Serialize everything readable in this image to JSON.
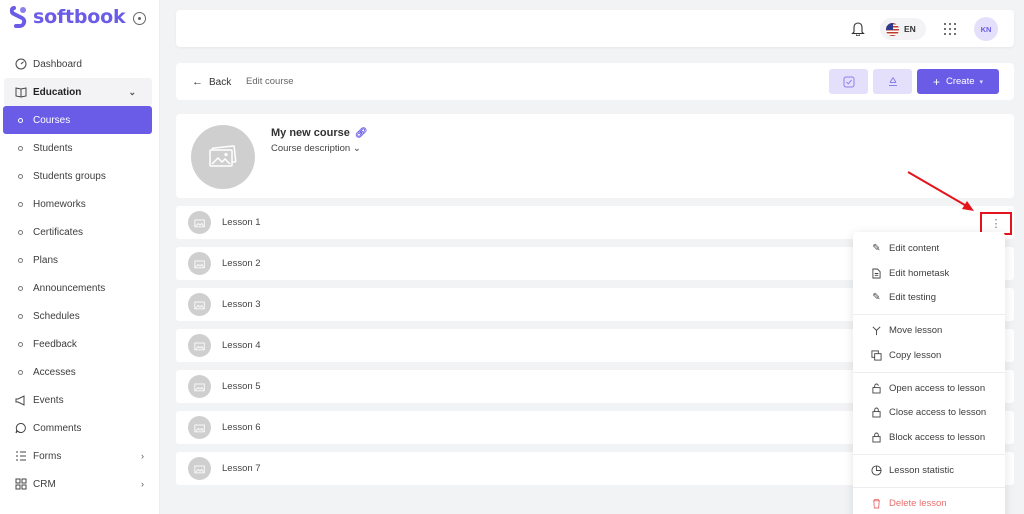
{
  "brand": {
    "name": "softbook",
    "color": "#6b5ce7"
  },
  "sidebar": {
    "items": [
      {
        "label": "Dashboard",
        "icon": "dashboard-gauge-icon",
        "type": "top"
      },
      {
        "label": "Education",
        "icon": "book-icon",
        "type": "group",
        "expanded": true
      },
      {
        "label": "Courses",
        "type": "sub",
        "active": true
      },
      {
        "label": "Students",
        "type": "sub"
      },
      {
        "label": "Students groups",
        "type": "sub"
      },
      {
        "label": "Homeworks",
        "type": "sub"
      },
      {
        "label": "Certificates",
        "type": "sub"
      },
      {
        "label": "Plans",
        "type": "sub"
      },
      {
        "label": "Announcements",
        "type": "sub"
      },
      {
        "label": "Schedules",
        "type": "sub"
      },
      {
        "label": "Feedback",
        "type": "sub"
      },
      {
        "label": "Accesses",
        "type": "sub"
      },
      {
        "label": "Events",
        "icon": "megaphone-icon",
        "type": "top"
      },
      {
        "label": "Comments",
        "icon": "chat-bubble-icon",
        "type": "top"
      },
      {
        "label": "Forms",
        "icon": "form-list-icon",
        "type": "top",
        "expandable": true
      },
      {
        "label": "CRM",
        "icon": "crm-grid-icon",
        "type": "top",
        "expandable": true
      }
    ]
  },
  "topbar": {
    "language": "EN",
    "avatar_initials": "KN"
  },
  "header": {
    "back_label": "Back",
    "breadcrumb": "Edit course",
    "create_label": "Create"
  },
  "course": {
    "title": "My new course",
    "description_label": "Course description"
  },
  "lessons": [
    "Lesson 1",
    "Lesson 2",
    "Lesson 3",
    "Lesson 4",
    "Lesson 5",
    "Lesson 6",
    "Lesson 7"
  ],
  "menu": {
    "items": [
      {
        "label": "Edit content",
        "icon": "edit-pencil-icon"
      },
      {
        "label": "Edit hometask",
        "icon": "document-icon"
      },
      {
        "label": "Edit testing",
        "icon": "edit-check-icon"
      },
      {
        "label": "Move lesson",
        "icon": "branch-icon"
      },
      {
        "label": "Copy lesson",
        "icon": "copy-icon"
      },
      {
        "label": "Open access to lesson",
        "icon": "unlock-icon"
      },
      {
        "label": "Close access to lesson",
        "icon": "lock-icon"
      },
      {
        "label": "Block access to lesson",
        "icon": "lock-icon"
      },
      {
        "label": "Lesson statistic",
        "icon": "pie-chart-icon"
      },
      {
        "label": "Delete lesson",
        "icon": "trash-icon",
        "danger": true
      }
    ]
  },
  "colors": {
    "accent": "#6b5ce7",
    "accent_light": "#e4e0fb",
    "danger": "#e86f6f",
    "highlight": "#e3141b"
  }
}
